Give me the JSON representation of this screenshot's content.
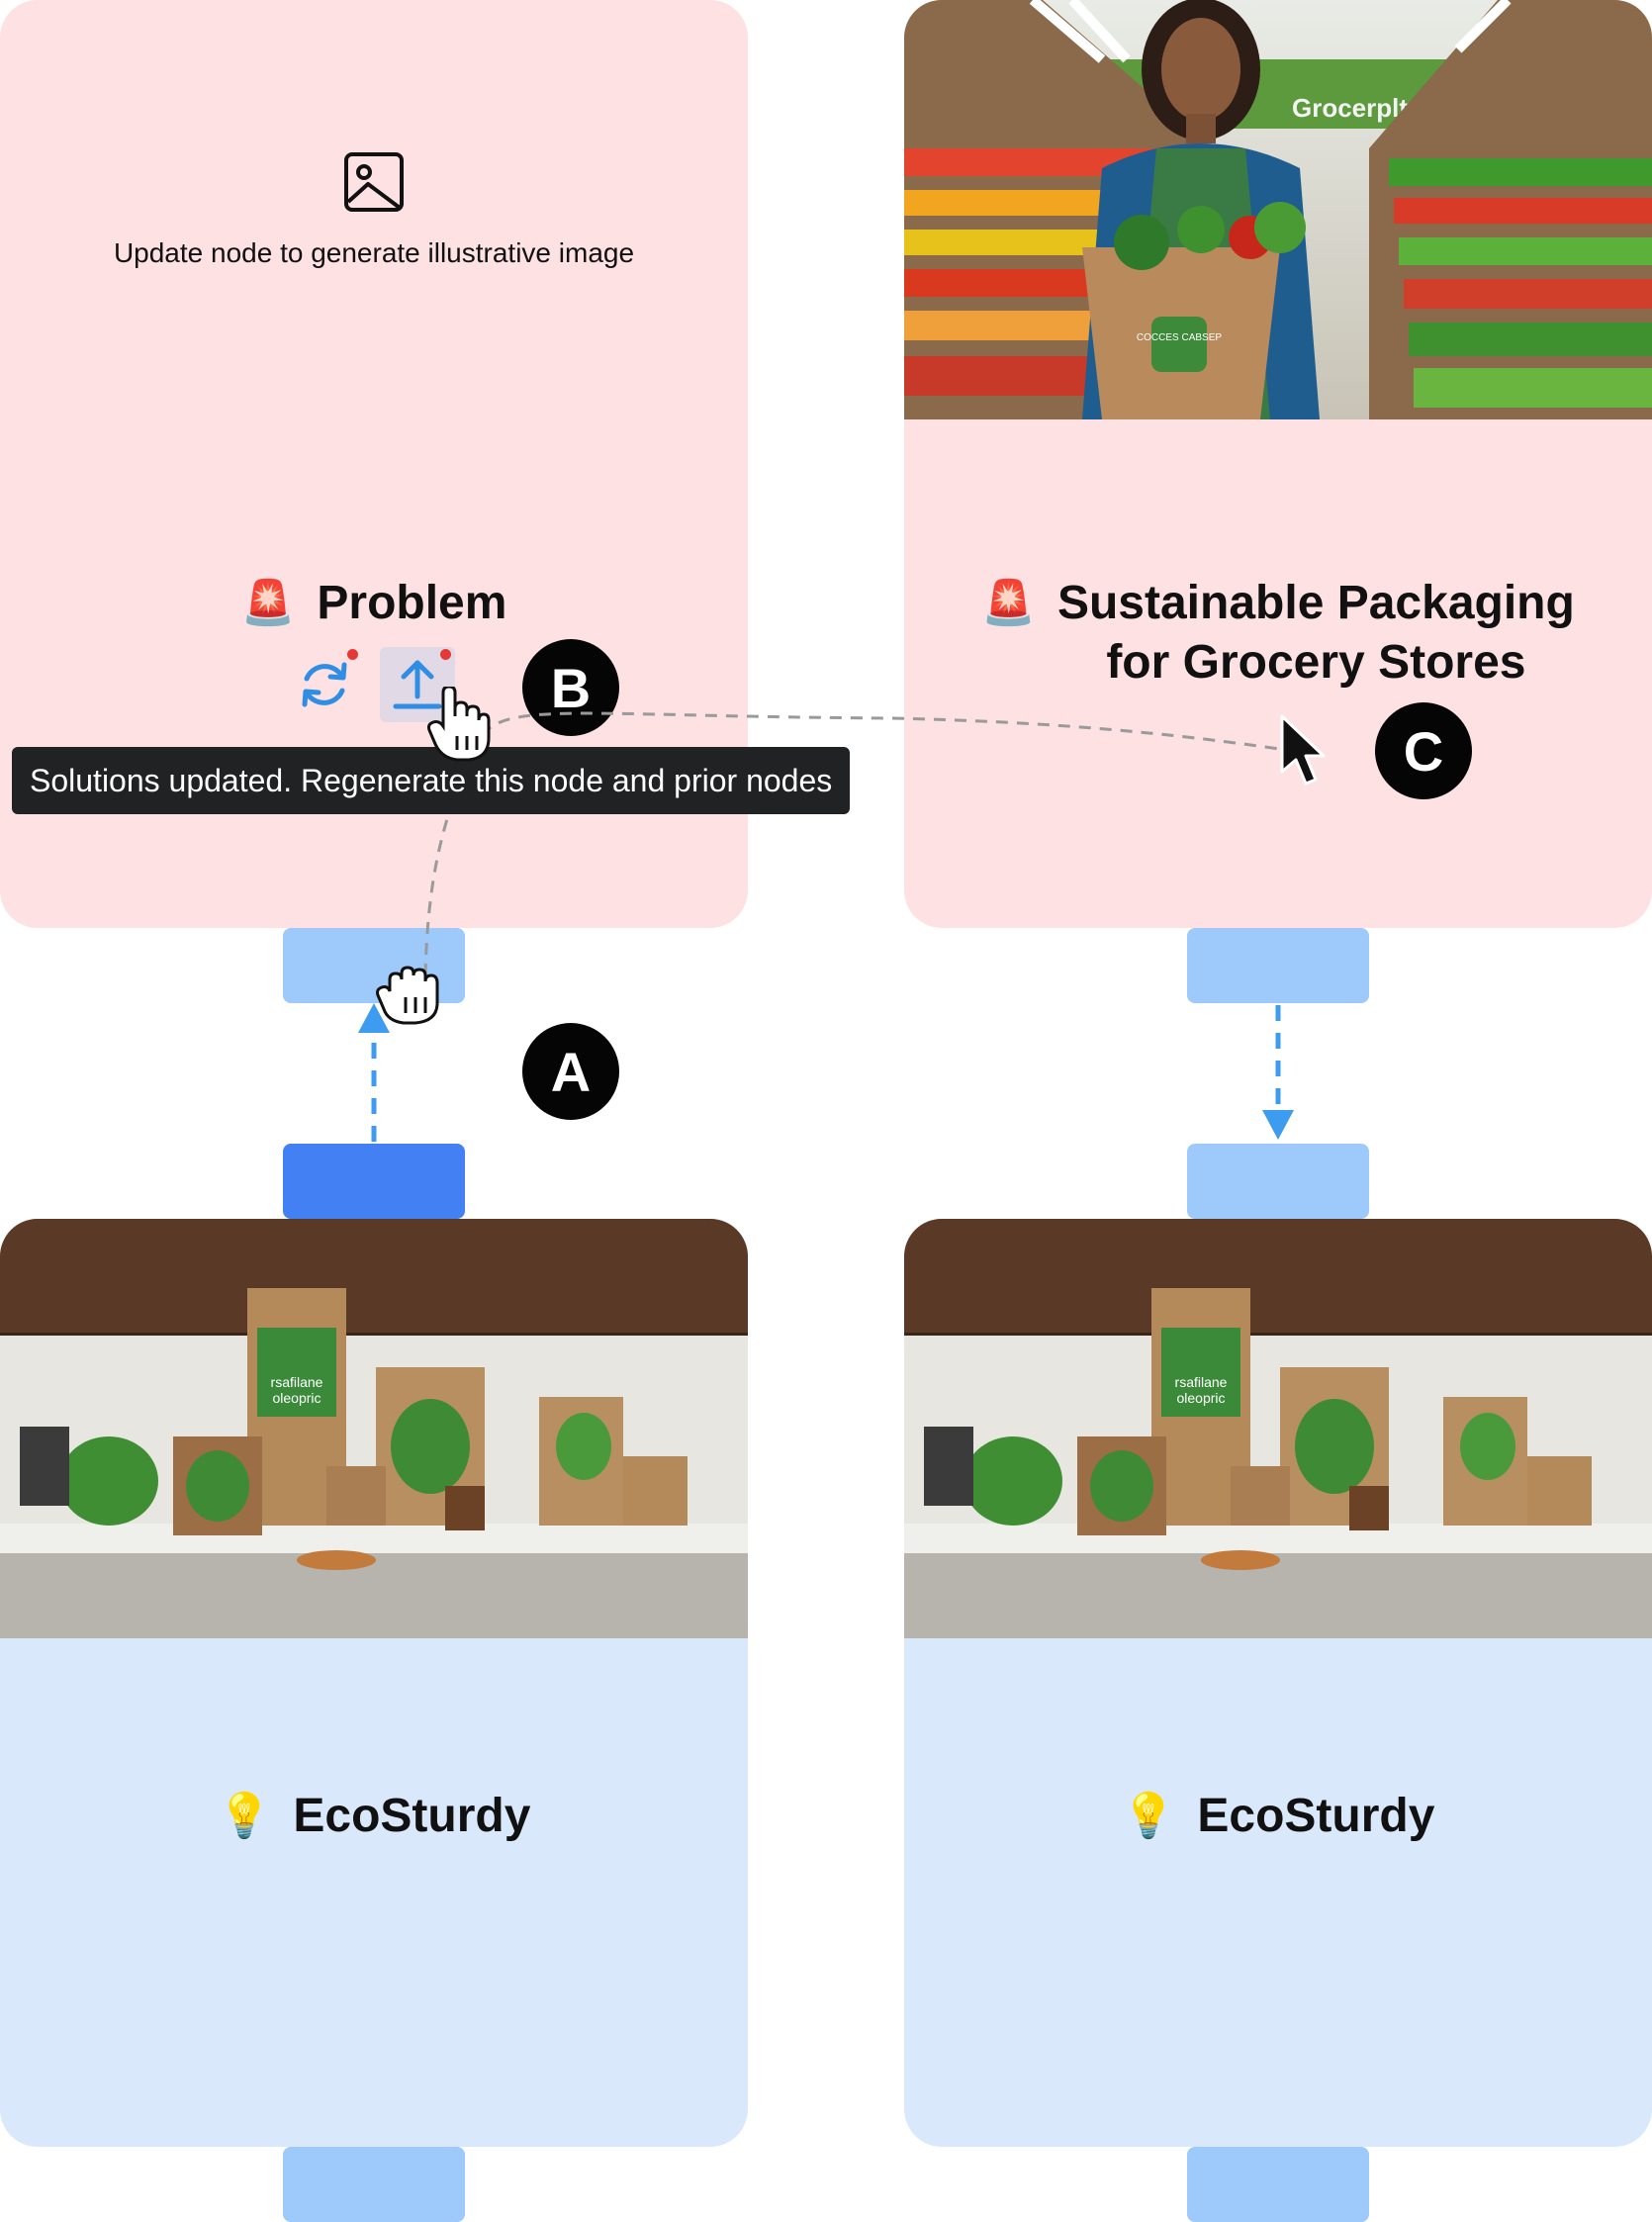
{
  "nodes": {
    "problem_left": {
      "placeholder_text": "Update node to generate illustrative image",
      "title": "Problem",
      "emoji": "🚨",
      "actions": {
        "regenerate_icon": "refresh-icon",
        "update_icon": "upload-icon"
      }
    },
    "problem_right": {
      "title_line1": "Sustainable Packaging",
      "title_line2": "for Grocery Stores",
      "emoji": "🚨",
      "image_subject": "grocery-worker-with-produce-bag",
      "store_sign": "Grocerplty",
      "bag_label": "COCCES CABSEP"
    },
    "solution_left": {
      "title": "EcoSturdy",
      "emoji": "💡",
      "image_subject": "eco-packaging-kitchen",
      "box_label_line1": "rsafilane",
      "box_label_line2": "oleopric"
    },
    "solution_right": {
      "title": "EcoSturdy",
      "emoji": "💡",
      "image_subject": "eco-packaging-kitchen",
      "box_label_line1": "rsafilane",
      "box_label_line2": "oleopric"
    }
  },
  "tooltip": {
    "text": "Solutions updated. Regenerate this node and prior nodes"
  },
  "badges": {
    "a": "A",
    "b": "B",
    "c": "C"
  },
  "colors": {
    "problem_bg": "#fde1e3",
    "solution_bg": "#dae8fc",
    "handle": "#9ec9fb",
    "handle_active": "#4280f4",
    "edge": "#3d9bf0",
    "alert_dot": "#e53935"
  }
}
